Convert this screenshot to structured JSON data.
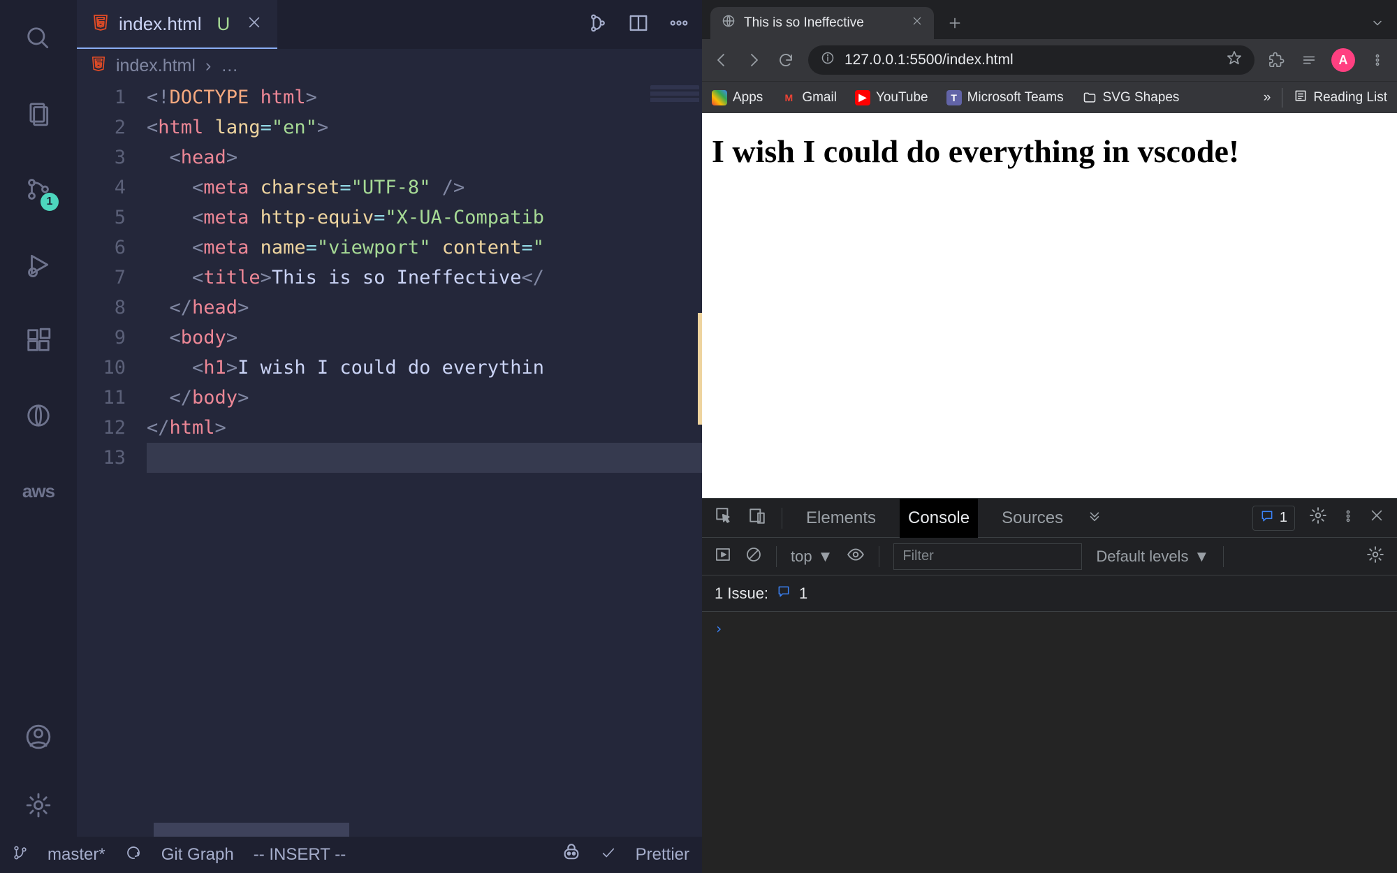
{
  "vscode": {
    "tab": {
      "filename": "index.html",
      "modified": "U"
    },
    "breadcrumb": {
      "filename": "index.html",
      "more": "…"
    },
    "gutter": [
      "1",
      "2",
      "3",
      "4",
      "5",
      "6",
      "7",
      "8",
      "9",
      "10",
      "11",
      "12",
      "13"
    ],
    "scm_badge": "1",
    "aws_label": "aws",
    "status": {
      "branch": "master*",
      "git_graph": "Git Graph",
      "mode": "-- INSERT --",
      "prettier": "Prettier"
    }
  },
  "browser": {
    "tab_title": "This is so Ineffective",
    "url": "127.0.0.1:5500/index.html",
    "avatar_letter": "A",
    "bookmarks": {
      "apps": "Apps",
      "gmail": "Gmail",
      "youtube": "YouTube",
      "teams": "Microsoft Teams",
      "svg": "SVG Shapes",
      "more": "»",
      "reading": "Reading List"
    },
    "page_heading": "I wish I could do everything in vscode!"
  },
  "devtools": {
    "tabs": {
      "elements": "Elements",
      "console": "Console",
      "sources": "Sources"
    },
    "issue_count": "1",
    "context": "top",
    "filter_placeholder": "Filter",
    "levels": "Default levels",
    "issues_label": "1 Issue:",
    "issues_badge": "1"
  }
}
